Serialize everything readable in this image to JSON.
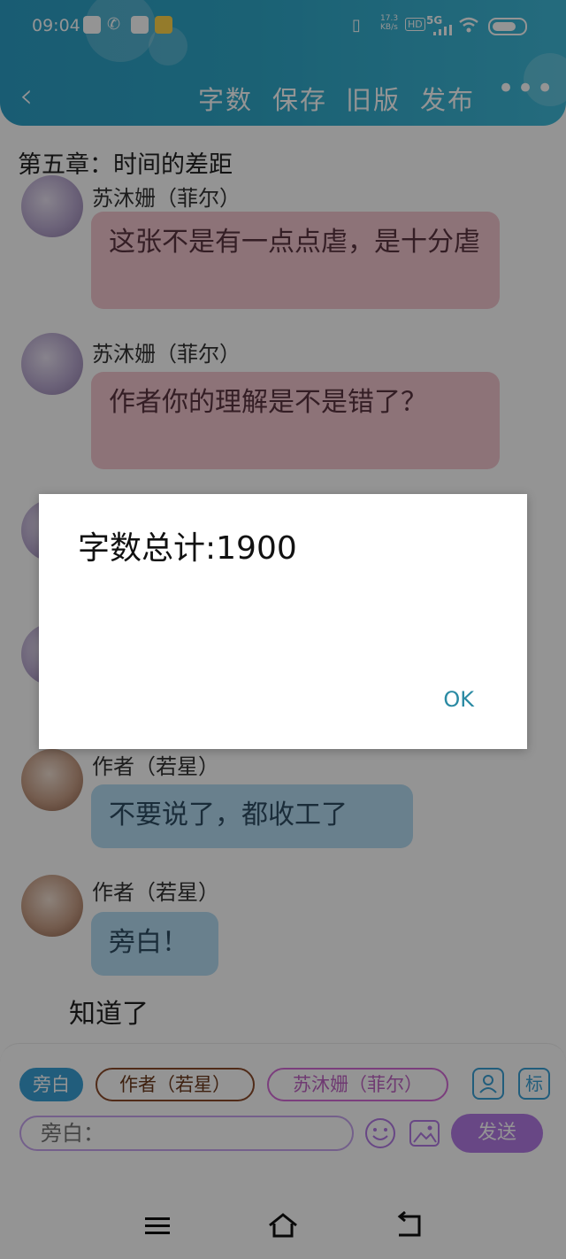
{
  "status_bar": {
    "time": "09:04",
    "network_speed": "17.3",
    "network_unit": "KB/s",
    "hd": "HD",
    "signal": "5G",
    "battery_level": 0.85
  },
  "header": {
    "actions": {
      "word_count": "字数",
      "save": "保存",
      "old_version": "旧版",
      "publish": "发布"
    },
    "more": "•••"
  },
  "chapter_title": "第五章：时间的差距",
  "messages": [
    {
      "sender": "苏沐姗（菲尔）",
      "text": "这张不是有一点点虐，是十分虐"
    },
    {
      "sender": "苏沐姗（菲尔）",
      "text": "作者你的理解是不是错了？"
    },
    {
      "sender": "作者（若星）",
      "text": "不要说了，都收工了"
    },
    {
      "sender": "作者（若星）",
      "text": "旁白！"
    }
  ],
  "narration_text": "知道了",
  "composer": {
    "chips": [
      "旁白",
      "作者（若星）",
      "苏沐姗（菲尔）"
    ],
    "mark_button": "标",
    "input_placeholder": "旁白：",
    "send_label": "发送"
  },
  "dialog": {
    "message": "字数总计:1900",
    "ok_label": "OK"
  },
  "colors": {
    "header": "#2fa8c9",
    "pink_bubble": "#f3c6cf",
    "blue_bubble": "#b6dcf3",
    "send": "#b47be6",
    "ok": "#2a8aa3"
  }
}
